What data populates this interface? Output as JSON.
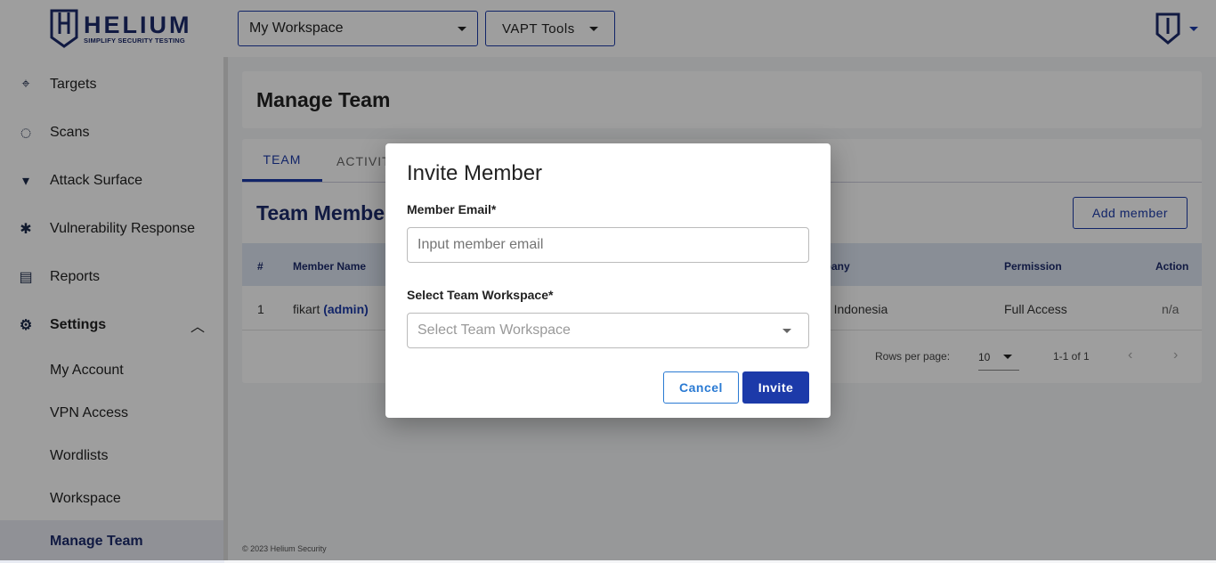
{
  "header": {
    "logo_name": "HELIUM",
    "logo_tagline": "SIMPLIFY SECURITY TESTING",
    "workspace": "My Workspace",
    "tools": "VAPT Tools"
  },
  "sidebar": {
    "items": [
      {
        "label": "Targets",
        "icon": "target-icon"
      },
      {
        "label": "Scans",
        "icon": "scan-icon"
      },
      {
        "label": "Attack Surface",
        "icon": "wifi-icon"
      },
      {
        "label": "Vulnerability Response",
        "icon": "bug-icon"
      },
      {
        "label": "Reports",
        "icon": "report-icon"
      },
      {
        "label": "Settings",
        "icon": "gear-icon"
      }
    ],
    "settings_sub": [
      "My Account",
      "VPN Access",
      "Wordlists",
      "Workspace",
      "Manage Team"
    ]
  },
  "page": {
    "title": "Manage Team",
    "tabs": [
      "TEAM",
      "ACTIVITY"
    ],
    "section_title": "Team Members",
    "add_member": "Add member",
    "columns": [
      "#",
      "Member Name",
      "Company",
      "Permission",
      "Action"
    ],
    "rows": [
      {
        "no": "1",
        "name": "fikart",
        "role": "(admin)",
        "company": "Siber Indonesia",
        "permission": "Full Access",
        "action": "n/a"
      }
    ],
    "rows_per_page_label": "Rows per page:",
    "rows_per_page": "10",
    "range": "1-1 of 1",
    "footer": "© 2023 Helium Security"
  },
  "modal": {
    "title": "Invite Member",
    "email_label": "Member Email*",
    "email_placeholder": "Input member email",
    "workspace_label": "Select Team Workspace*",
    "workspace_placeholder": "Select Team Workspace",
    "cancel": "Cancel",
    "invite": "Invite"
  },
  "colors": {
    "primary": "#1c3aa9",
    "navy": "#1c2a6b"
  }
}
